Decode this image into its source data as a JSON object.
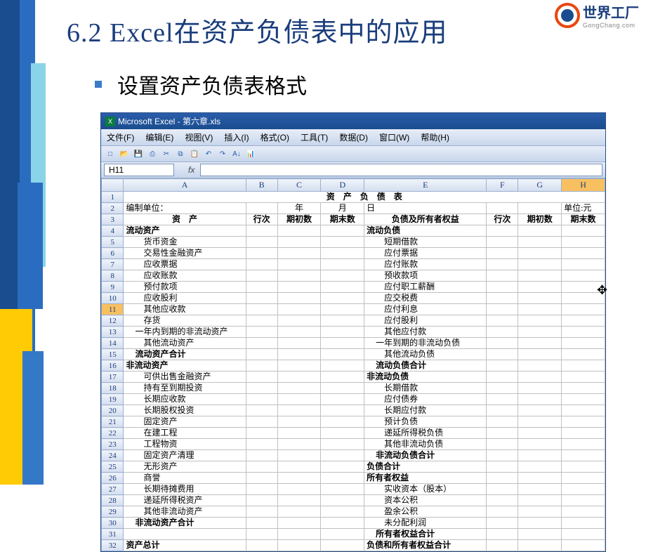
{
  "title": "6.2  Excel在资产负债表中的应用",
  "subtitle": "设置资产负债表格式",
  "logo": {
    "cn": "世界工厂",
    "en": "GongChang.com"
  },
  "window_title": "Microsoft Excel - 第六章.xls",
  "menu": [
    "文件(F)",
    "编辑(E)",
    "视图(V)",
    "插入(I)",
    "格式(O)",
    "工具(T)",
    "数据(D)",
    "窗口(W)",
    "帮助(H)"
  ],
  "name_box": "H11",
  "fx_label": "fx",
  "columns": [
    "A",
    "B",
    "C",
    "D",
    "E",
    "F",
    "G",
    "H"
  ],
  "rows": [
    {
      "n": 1,
      "cells": [
        {
          "t": "资　产　负　债　表",
          "span": 8,
          "cls": "center bold"
        }
      ]
    },
    {
      "n": 2,
      "cells": [
        {
          "t": "编制单位："
        },
        {
          "t": ""
        },
        {
          "t": "年",
          "cls": "center"
        },
        {
          "t": "月",
          "cls": "center"
        },
        {
          "t": "日"
        },
        {
          "t": ""
        },
        {
          "t": ""
        },
        {
          "t": "单位:元"
        }
      ]
    },
    {
      "n": 3,
      "cells": [
        {
          "t": "资　产",
          "cls": "center bold"
        },
        {
          "t": "行次",
          "cls": "center bold"
        },
        {
          "t": "期初数",
          "cls": "center bold"
        },
        {
          "t": "期末数",
          "cls": "center bold"
        },
        {
          "t": "负债及所有者权益",
          "cls": "center bold"
        },
        {
          "t": "行次",
          "cls": "center bold"
        },
        {
          "t": "期初数",
          "cls": "center bold"
        },
        {
          "t": "期末数",
          "cls": "center bold"
        }
      ]
    },
    {
      "n": 4,
      "cells": [
        {
          "t": "流动资产",
          "cls": "bold"
        },
        {
          "t": ""
        },
        {
          "t": ""
        },
        {
          "t": ""
        },
        {
          "t": "流动负债",
          "cls": "bold"
        },
        {
          "t": ""
        },
        {
          "t": ""
        },
        {
          "t": ""
        }
      ]
    },
    {
      "n": 5,
      "cells": [
        {
          "t": "货币资金",
          "cls": "indent2"
        },
        {
          "t": ""
        },
        {
          "t": ""
        },
        {
          "t": ""
        },
        {
          "t": "短期借款",
          "cls": "indent2"
        },
        {
          "t": ""
        },
        {
          "t": ""
        },
        {
          "t": ""
        }
      ]
    },
    {
      "n": 6,
      "cells": [
        {
          "t": "交易性金融资产",
          "cls": "indent2"
        },
        {
          "t": ""
        },
        {
          "t": ""
        },
        {
          "t": ""
        },
        {
          "t": "应付票据",
          "cls": "indent2"
        },
        {
          "t": ""
        },
        {
          "t": ""
        },
        {
          "t": ""
        }
      ]
    },
    {
      "n": 7,
      "cells": [
        {
          "t": "应收票据",
          "cls": "indent2"
        },
        {
          "t": ""
        },
        {
          "t": ""
        },
        {
          "t": ""
        },
        {
          "t": "应付账款",
          "cls": "indent2"
        },
        {
          "t": ""
        },
        {
          "t": ""
        },
        {
          "t": ""
        }
      ]
    },
    {
      "n": 8,
      "cells": [
        {
          "t": "应收账款",
          "cls": "indent2"
        },
        {
          "t": ""
        },
        {
          "t": ""
        },
        {
          "t": ""
        },
        {
          "t": "预收款项",
          "cls": "indent2"
        },
        {
          "t": ""
        },
        {
          "t": ""
        },
        {
          "t": ""
        }
      ]
    },
    {
      "n": 9,
      "cells": [
        {
          "t": "预付款项",
          "cls": "indent2"
        },
        {
          "t": ""
        },
        {
          "t": ""
        },
        {
          "t": ""
        },
        {
          "t": "应付职工薪酬",
          "cls": "indent2"
        },
        {
          "t": ""
        },
        {
          "t": ""
        },
        {
          "t": ""
        }
      ]
    },
    {
      "n": 10,
      "cells": [
        {
          "t": "应收股利",
          "cls": "indent2"
        },
        {
          "t": ""
        },
        {
          "t": ""
        },
        {
          "t": ""
        },
        {
          "t": "应交税费",
          "cls": "indent2"
        },
        {
          "t": ""
        },
        {
          "t": ""
        },
        {
          "t": ""
        }
      ]
    },
    {
      "n": 11,
      "cells": [
        {
          "t": "其他应收款",
          "cls": "indent2"
        },
        {
          "t": ""
        },
        {
          "t": ""
        },
        {
          "t": ""
        },
        {
          "t": "应付利息",
          "cls": "indent2"
        },
        {
          "t": ""
        },
        {
          "t": ""
        },
        {
          "t": ""
        }
      ],
      "selected": true
    },
    {
      "n": 12,
      "cells": [
        {
          "t": "存货",
          "cls": "indent2"
        },
        {
          "t": ""
        },
        {
          "t": ""
        },
        {
          "t": ""
        },
        {
          "t": "应付股利",
          "cls": "indent2"
        },
        {
          "t": ""
        },
        {
          "t": ""
        },
        {
          "t": ""
        }
      ]
    },
    {
      "n": 13,
      "cells": [
        {
          "t": "一年内到期的非流动资产",
          "cls": "indent1"
        },
        {
          "t": ""
        },
        {
          "t": ""
        },
        {
          "t": ""
        },
        {
          "t": "其他应付款",
          "cls": "indent2"
        },
        {
          "t": ""
        },
        {
          "t": ""
        },
        {
          "t": ""
        }
      ]
    },
    {
      "n": 14,
      "cells": [
        {
          "t": "其他流动资产",
          "cls": "indent2"
        },
        {
          "t": ""
        },
        {
          "t": ""
        },
        {
          "t": ""
        },
        {
          "t": "一年到期的非流动负债",
          "cls": "indent1"
        },
        {
          "t": ""
        },
        {
          "t": ""
        },
        {
          "t": ""
        }
      ]
    },
    {
      "n": 15,
      "cells": [
        {
          "t": "流动资产合计",
          "cls": "indent1 bold"
        },
        {
          "t": ""
        },
        {
          "t": ""
        },
        {
          "t": ""
        },
        {
          "t": "其他流动负债",
          "cls": "indent2"
        },
        {
          "t": ""
        },
        {
          "t": ""
        },
        {
          "t": ""
        }
      ]
    },
    {
      "n": 16,
      "cells": [
        {
          "t": "非流动资产",
          "cls": "bold"
        },
        {
          "t": ""
        },
        {
          "t": ""
        },
        {
          "t": ""
        },
        {
          "t": "流动负债合计",
          "cls": "indent1 bold"
        },
        {
          "t": ""
        },
        {
          "t": ""
        },
        {
          "t": ""
        }
      ]
    },
    {
      "n": 17,
      "cells": [
        {
          "t": "可供出售金融资产",
          "cls": "indent2"
        },
        {
          "t": ""
        },
        {
          "t": ""
        },
        {
          "t": ""
        },
        {
          "t": "非流动负债",
          "cls": "bold"
        },
        {
          "t": ""
        },
        {
          "t": ""
        },
        {
          "t": ""
        }
      ]
    },
    {
      "n": 18,
      "cells": [
        {
          "t": "持有至到期投资",
          "cls": "indent2"
        },
        {
          "t": ""
        },
        {
          "t": ""
        },
        {
          "t": ""
        },
        {
          "t": "长期借款",
          "cls": "indent2"
        },
        {
          "t": ""
        },
        {
          "t": ""
        },
        {
          "t": ""
        }
      ]
    },
    {
      "n": 19,
      "cells": [
        {
          "t": "长期应收款",
          "cls": "indent2"
        },
        {
          "t": ""
        },
        {
          "t": ""
        },
        {
          "t": ""
        },
        {
          "t": "应付债券",
          "cls": "indent2"
        },
        {
          "t": ""
        },
        {
          "t": ""
        },
        {
          "t": ""
        }
      ]
    },
    {
      "n": 20,
      "cells": [
        {
          "t": "长期股权投资",
          "cls": "indent2"
        },
        {
          "t": ""
        },
        {
          "t": ""
        },
        {
          "t": ""
        },
        {
          "t": "长期应付款",
          "cls": "indent2"
        },
        {
          "t": ""
        },
        {
          "t": ""
        },
        {
          "t": ""
        }
      ]
    },
    {
      "n": 21,
      "cells": [
        {
          "t": "固定资产",
          "cls": "indent2"
        },
        {
          "t": ""
        },
        {
          "t": ""
        },
        {
          "t": ""
        },
        {
          "t": "预计负债",
          "cls": "indent2"
        },
        {
          "t": ""
        },
        {
          "t": ""
        },
        {
          "t": ""
        }
      ]
    },
    {
      "n": 22,
      "cells": [
        {
          "t": "在建工程",
          "cls": "indent2"
        },
        {
          "t": ""
        },
        {
          "t": ""
        },
        {
          "t": ""
        },
        {
          "t": "递延所得税负债",
          "cls": "indent2"
        },
        {
          "t": ""
        },
        {
          "t": ""
        },
        {
          "t": ""
        }
      ]
    },
    {
      "n": 23,
      "cells": [
        {
          "t": "工程物资",
          "cls": "indent2"
        },
        {
          "t": ""
        },
        {
          "t": ""
        },
        {
          "t": ""
        },
        {
          "t": "其他非流动负债",
          "cls": "indent2"
        },
        {
          "t": ""
        },
        {
          "t": ""
        },
        {
          "t": ""
        }
      ]
    },
    {
      "n": 24,
      "cells": [
        {
          "t": "固定资产清理",
          "cls": "indent2"
        },
        {
          "t": ""
        },
        {
          "t": ""
        },
        {
          "t": ""
        },
        {
          "t": "非流动负债合计",
          "cls": "indent1 bold"
        },
        {
          "t": ""
        },
        {
          "t": ""
        },
        {
          "t": ""
        }
      ]
    },
    {
      "n": 25,
      "cells": [
        {
          "t": "无形资产",
          "cls": "indent2"
        },
        {
          "t": ""
        },
        {
          "t": ""
        },
        {
          "t": ""
        },
        {
          "t": "负债合计",
          "cls": "bold"
        },
        {
          "t": ""
        },
        {
          "t": ""
        },
        {
          "t": ""
        }
      ]
    },
    {
      "n": 26,
      "cells": [
        {
          "t": "商誉",
          "cls": "indent2"
        },
        {
          "t": ""
        },
        {
          "t": ""
        },
        {
          "t": ""
        },
        {
          "t": "所有者权益",
          "cls": "bold"
        },
        {
          "t": ""
        },
        {
          "t": ""
        },
        {
          "t": ""
        }
      ]
    },
    {
      "n": 27,
      "cells": [
        {
          "t": "长期待摊费用",
          "cls": "indent2"
        },
        {
          "t": ""
        },
        {
          "t": ""
        },
        {
          "t": ""
        },
        {
          "t": "实收资本（股本）",
          "cls": "indent2"
        },
        {
          "t": ""
        },
        {
          "t": ""
        },
        {
          "t": ""
        }
      ]
    },
    {
      "n": 28,
      "cells": [
        {
          "t": "递延所得税资产",
          "cls": "indent2"
        },
        {
          "t": ""
        },
        {
          "t": ""
        },
        {
          "t": ""
        },
        {
          "t": "资本公积",
          "cls": "indent2"
        },
        {
          "t": ""
        },
        {
          "t": ""
        },
        {
          "t": ""
        }
      ]
    },
    {
      "n": 29,
      "cells": [
        {
          "t": "其他非流动资产",
          "cls": "indent2"
        },
        {
          "t": ""
        },
        {
          "t": ""
        },
        {
          "t": ""
        },
        {
          "t": "盈余公积",
          "cls": "indent2"
        },
        {
          "t": ""
        },
        {
          "t": ""
        },
        {
          "t": ""
        }
      ]
    },
    {
      "n": 30,
      "cells": [
        {
          "t": "非流动资产合计",
          "cls": "indent1 bold"
        },
        {
          "t": ""
        },
        {
          "t": ""
        },
        {
          "t": ""
        },
        {
          "t": "未分配利润",
          "cls": "indent2"
        },
        {
          "t": ""
        },
        {
          "t": ""
        },
        {
          "t": ""
        }
      ]
    },
    {
      "n": 31,
      "cells": [
        {
          "t": ""
        },
        {
          "t": ""
        },
        {
          "t": ""
        },
        {
          "t": ""
        },
        {
          "t": "所有者权益合计",
          "cls": "indent1 bold"
        },
        {
          "t": ""
        },
        {
          "t": ""
        },
        {
          "t": ""
        }
      ]
    },
    {
      "n": 32,
      "cells": [
        {
          "t": "资产总计",
          "cls": "bold"
        },
        {
          "t": ""
        },
        {
          "t": ""
        },
        {
          "t": ""
        },
        {
          "t": "负债和所有者权益合计",
          "cls": "bold"
        },
        {
          "t": ""
        },
        {
          "t": ""
        },
        {
          "t": ""
        }
      ]
    }
  ]
}
